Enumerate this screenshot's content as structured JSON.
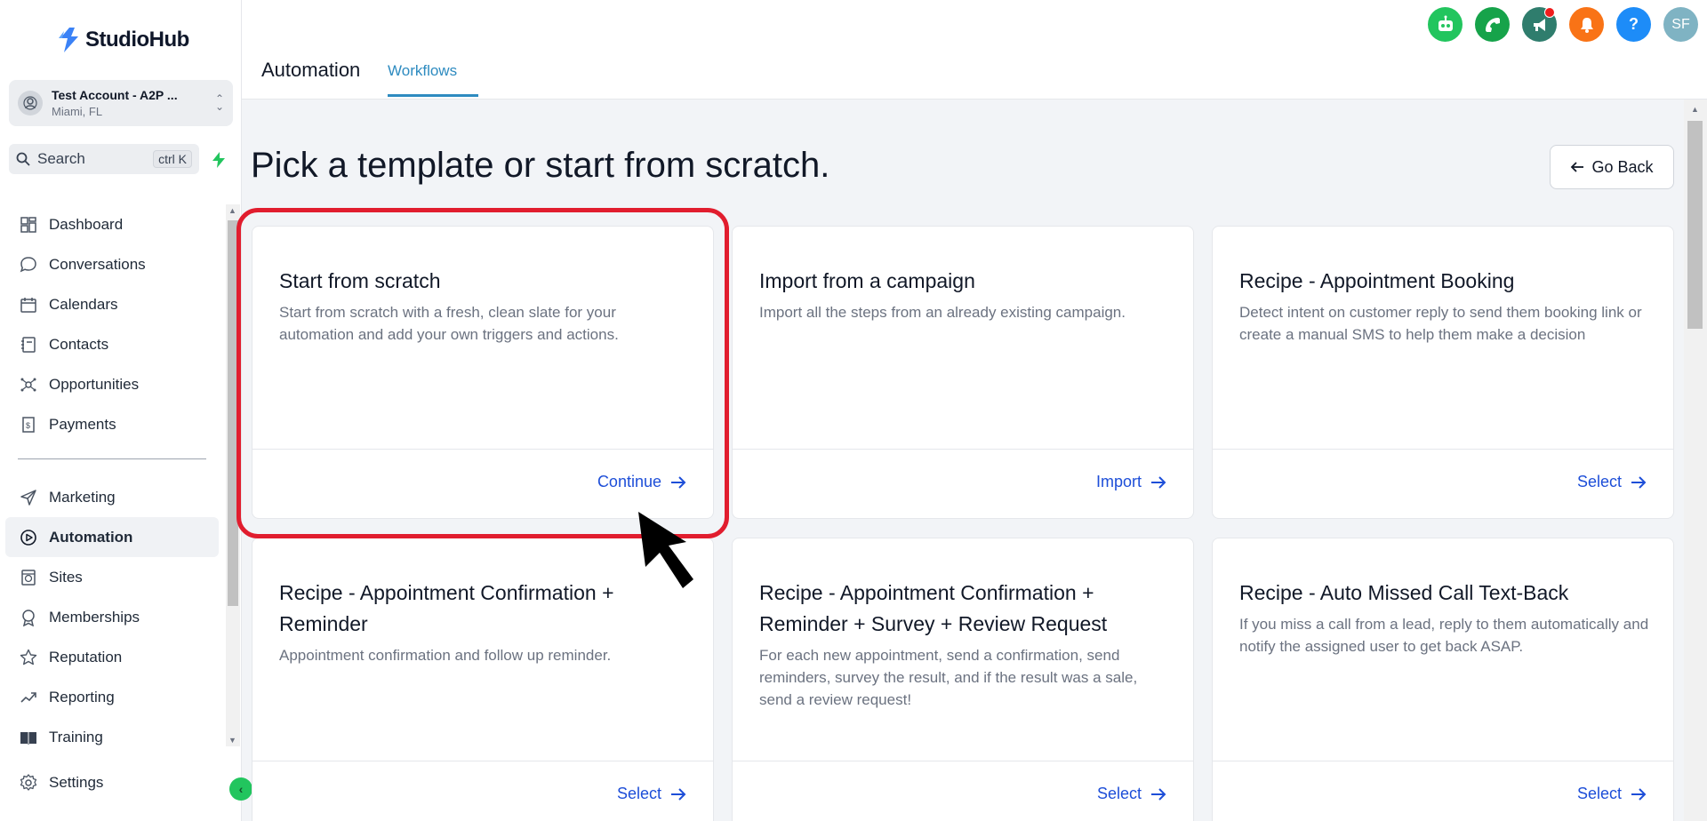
{
  "app": {
    "name": "StudioHub"
  },
  "account": {
    "name": "Test Account - A2P ...",
    "location": "Miami, FL"
  },
  "search": {
    "label": "Search",
    "shortcut": "ctrl K"
  },
  "sidebar": {
    "items": [
      {
        "label": "Dashboard",
        "icon": "dashboard-icon"
      },
      {
        "label": "Conversations",
        "icon": "chat-icon"
      },
      {
        "label": "Calendars",
        "icon": "calendar-icon"
      },
      {
        "label": "Contacts",
        "icon": "contacts-icon"
      },
      {
        "label": "Opportunities",
        "icon": "opportunities-icon"
      },
      {
        "label": "Payments",
        "icon": "payments-icon"
      }
    ],
    "items2": [
      {
        "label": "Marketing",
        "icon": "send-icon"
      },
      {
        "label": "Automation",
        "icon": "automation-icon",
        "active": true
      },
      {
        "label": "Sites",
        "icon": "sites-icon"
      },
      {
        "label": "Memberships",
        "icon": "memberships-icon"
      },
      {
        "label": "Reputation",
        "icon": "star-icon"
      },
      {
        "label": "Reporting",
        "icon": "trend-icon"
      },
      {
        "label": "Training",
        "icon": "book-icon"
      }
    ],
    "settings": "Settings"
  },
  "header": {
    "title": "Automation",
    "tab": "Workflows",
    "avatar_initials": "SF",
    "help_label": "?"
  },
  "main": {
    "title": "Pick a template or start from scratch.",
    "back_label": "Go Back",
    "cards": [
      {
        "title": "Start from scratch",
        "description": "Start from scratch with a fresh, clean slate for your automation and add your own triggers and actions.",
        "action": "Continue"
      },
      {
        "title": "Import from a campaign",
        "description": "Import all the steps from an already existing campaign.",
        "action": "Import"
      },
      {
        "title": "Recipe - Appointment Booking",
        "description": "Detect intent on customer reply to send them booking link or create a manual SMS to help them make a decision",
        "action": "Select"
      },
      {
        "title": "Recipe - Appointment Confirmation + Reminder",
        "description": "Appointment confirmation and follow up reminder.",
        "action": "Select"
      },
      {
        "title": "Recipe - Appointment Confirmation + Reminder + Survey + Review Request",
        "description": "For each new appointment, send a confirmation, send reminders, survey the result, and if the result was a sale, send a review request!",
        "action": "Select"
      },
      {
        "title": "Recipe - Auto Missed Call Text-Back",
        "description": "If you miss a call from a lead, reply to them automatically and notify the assigned user to get back ASAP.",
        "action": "Select"
      }
    ]
  },
  "colors": {
    "accent": "#2e8bc0",
    "link": "#1d4ed8",
    "highlight": "#e11d2e",
    "robot": "#22c55e",
    "phone": "#16a34a",
    "megaphone": "#2f7d6d",
    "bell": "#f97316",
    "help": "#1d8cf8",
    "avatar": "#7fb3c3"
  }
}
